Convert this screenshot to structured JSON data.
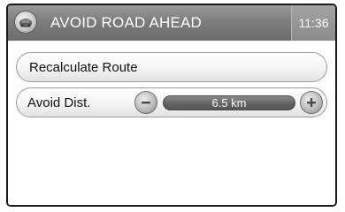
{
  "header": {
    "title": "AVOID ROAD AHEAD",
    "time": "11:36",
    "back_icon": "car-globe-icon"
  },
  "menu": {
    "recalculate_label": "Recalculate Route",
    "avoid_distance": {
      "label": "Avoid Dist.",
      "value": "6.5 km",
      "decrease_icon": "minus-icon",
      "increase_icon": "plus-icon"
    }
  },
  "colors": {
    "header_bg": "#7d7d7d",
    "value_bar_bg": "#616161",
    "pill_bg": "#f4f4f4"
  }
}
